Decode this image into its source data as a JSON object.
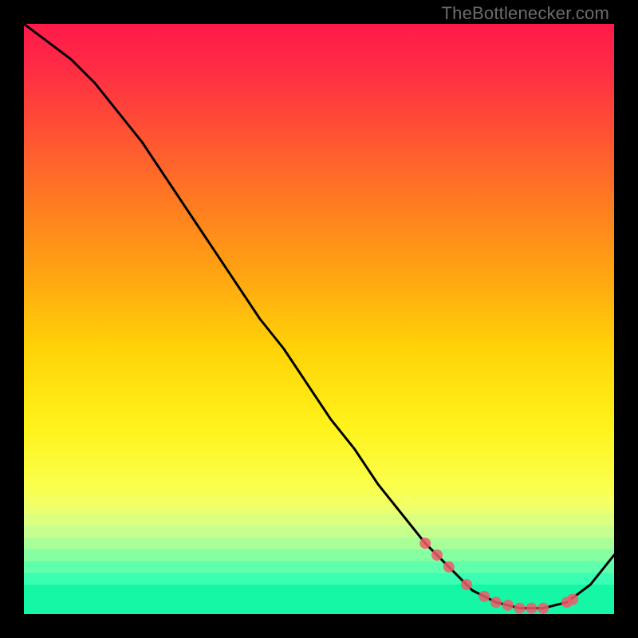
{
  "watermark": "TheBottlenecker.com",
  "chart_data": {
    "type": "line",
    "title": "",
    "xlabel": "",
    "ylabel": "",
    "xlim": [
      0,
      100
    ],
    "ylim": [
      0,
      100
    ],
    "series": [
      {
        "name": "curve",
        "x": [
          0,
          4,
          8,
          12,
          16,
          20,
          24,
          28,
          32,
          36,
          40,
          44,
          48,
          52,
          56,
          60,
          64,
          68,
          72,
          76,
          80,
          84,
          88,
          92,
          96,
          100
        ],
        "y": [
          100,
          97,
          94,
          90,
          85,
          80,
          74,
          68,
          62,
          56,
          50,
          45,
          39,
          33,
          28,
          22,
          17,
          12,
          8,
          4,
          2,
          1,
          1,
          2,
          5,
          10
        ]
      }
    ],
    "markers": {
      "name": "highlight-points",
      "x": [
        68,
        70,
        72,
        75,
        78,
        80,
        82,
        84,
        86,
        88,
        92,
        93
      ],
      "y": [
        12,
        10,
        8,
        5,
        3,
        2,
        1.5,
        1,
        1,
        1,
        2,
        2.5
      ]
    },
    "gradient_stops": [
      {
        "offset": 0.0,
        "color": "#ff1a49"
      },
      {
        "offset": 0.07,
        "color": "#ff2a45"
      },
      {
        "offset": 0.18,
        "color": "#ff5034"
      },
      {
        "offset": 0.3,
        "color": "#ff7a22"
      },
      {
        "offset": 0.42,
        "color": "#ffa312"
      },
      {
        "offset": 0.55,
        "color": "#ffd308"
      },
      {
        "offset": 0.68,
        "color": "#fff21a"
      },
      {
        "offset": 0.78,
        "color": "#faff4a"
      },
      {
        "offset": 0.86,
        "color": "#e8ff76"
      },
      {
        "offset": 0.92,
        "color": "#c7ff8f"
      },
      {
        "offset": 0.96,
        "color": "#8bffa0"
      },
      {
        "offset": 1.0,
        "color": "#2affb0"
      }
    ]
  }
}
